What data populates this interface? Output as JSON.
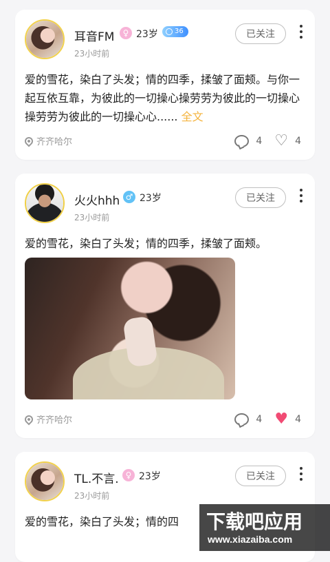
{
  "posts": [
    {
      "name": "耳音FM",
      "gender": "female",
      "gender_symbol": "♀",
      "age": "23岁",
      "level": "36",
      "time": "23小时前",
      "follow_label": "已关注",
      "text": "爱的雪花，染白了头发；情的四季，揉皱了面颊。与你一起互依互靠，为彼此的一切操心操劳劳为彼此的一切操心操劳劳为彼此的一切操心心......",
      "fulltext_label": "全文",
      "location": "齐齐哈尔",
      "comments": "4",
      "likes": "4",
      "liked": false
    },
    {
      "name": "火火hhh",
      "gender": "male",
      "gender_symbol": "♂",
      "age": "23岁",
      "time": "23小时前",
      "follow_label": "已关注",
      "text": "爱的雪花，染白了头发；情的四季，揉皱了面颊。",
      "location": "齐齐哈尔",
      "comments": "4",
      "likes": "4",
      "liked": true
    },
    {
      "name": "TL.不言.",
      "gender": "female",
      "gender_symbol": "♀",
      "age": "23岁",
      "time": "23小时前",
      "follow_label": "已关注",
      "text": "爱的雪花，染白了头发；情的四"
    }
  ],
  "watermark": {
    "title": "下载吧应用",
    "subtitle": "www.xiazaiba.com"
  }
}
